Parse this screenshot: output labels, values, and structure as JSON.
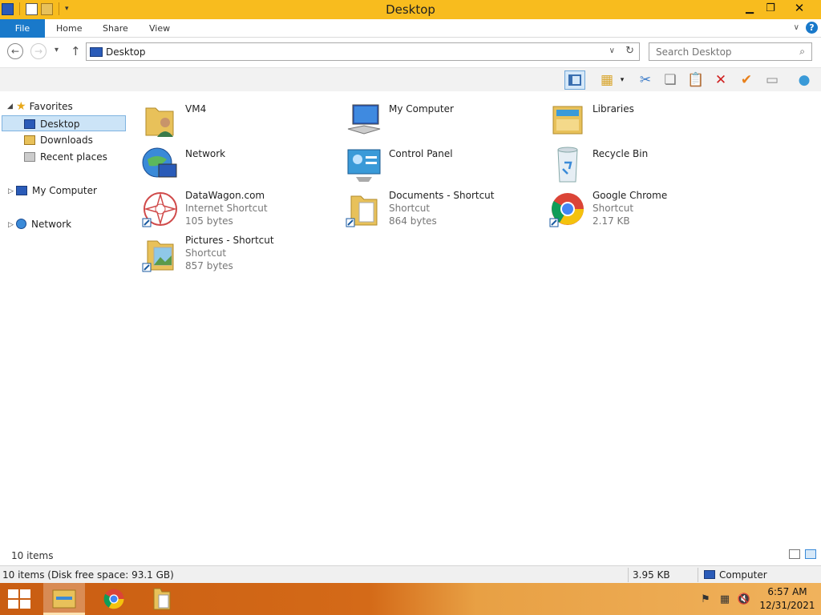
{
  "window": {
    "title": "Desktop"
  },
  "ribbon": {
    "tabs": [
      {
        "label": "File"
      },
      {
        "label": "Home"
      },
      {
        "label": "Share"
      },
      {
        "label": "View"
      }
    ],
    "help_label": "?"
  },
  "address": {
    "path": "Desktop",
    "search_placeholder": "Search Desktop"
  },
  "nav_pane": {
    "favorites": {
      "label": "Favorites"
    },
    "items": [
      {
        "label": "Desktop",
        "selected": true
      },
      {
        "label": "Downloads"
      },
      {
        "label": "Recent places"
      }
    ],
    "my_computer": {
      "label": "My Computer"
    },
    "network": {
      "label": "Network"
    }
  },
  "content": {
    "items": [
      {
        "name": "VM4",
        "icon": "user-folder-icon"
      },
      {
        "name": "My Computer",
        "icon": "computer-icon"
      },
      {
        "name": "Libraries",
        "icon": "libraries-icon"
      },
      {
        "name": "Network",
        "icon": "network-icon"
      },
      {
        "name": "Control Panel",
        "icon": "control-panel-icon"
      },
      {
        "name": "Recycle Bin",
        "icon": "recycle-bin-icon"
      },
      {
        "name": "DataWagon.com",
        "type": "Internet Shortcut",
        "size": "105 bytes",
        "icon": "internet-shortcut-icon"
      },
      {
        "name": "Documents - Shortcut",
        "type": "Shortcut",
        "size": "864 bytes",
        "icon": "documents-shortcut-icon"
      },
      {
        "name": "Google Chrome",
        "type": "Shortcut",
        "size": "2.17 KB",
        "icon": "chrome-icon"
      },
      {
        "name": "Pictures - Shortcut",
        "type": "Shortcut",
        "size": "857 bytes",
        "icon": "pictures-shortcut-icon"
      }
    ]
  },
  "status": {
    "item_count": "10 items",
    "details": "10 items (Disk free space: 93.1 GB)",
    "selection_size": "3.95 KB",
    "location": "Computer"
  },
  "taskbar": {
    "time": "6:57 AM",
    "date": "12/31/2021"
  },
  "colors": {
    "title_bar": "#f8bc1e",
    "file_tab": "#1979ca",
    "selection": "#cce4f7",
    "taskbar": "#d46a18"
  }
}
